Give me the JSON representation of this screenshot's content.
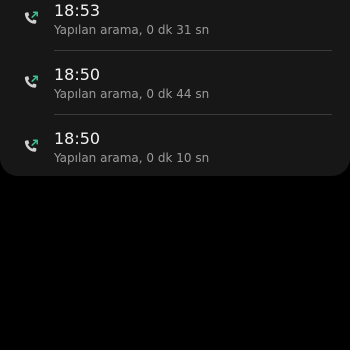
{
  "call_log": {
    "entries": [
      {
        "time": "18:53",
        "detail": "Yapılan arama, 0 dk 31 sn",
        "icon": "outgoing-call-icon"
      },
      {
        "time": "18:50",
        "detail": "Yapılan arama, 0 dk 44 sn",
        "icon": "outgoing-call-icon"
      },
      {
        "time": "18:50",
        "detail": "Yapılan arama, 0 dk 10 sn",
        "icon": "outgoing-call-icon"
      }
    ]
  },
  "colors": {
    "background": "#000000",
    "card": "#171717",
    "time_text": "#f2f2f2",
    "detail_text": "#9a9a9a",
    "divider": "#3a3a3a",
    "handset": "#d0d0d0",
    "outgoing_arrow": "#3ec28f"
  }
}
